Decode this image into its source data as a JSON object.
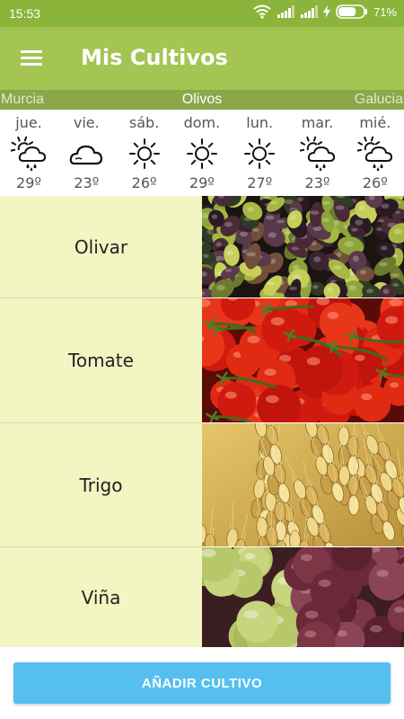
{
  "status_bar": {
    "time": "15:53",
    "battery": "71%",
    "battery_level": 0.71
  },
  "app_bar": {
    "title": "Mis Cultivos",
    "menu_icon": "hamburger-menu-icon"
  },
  "location_bar": {
    "previous": "Murcia",
    "current": "Olivos",
    "next": "Galucia"
  },
  "forecast": [
    {
      "day": "jue.",
      "icon": "sun-cloud-rain-icon",
      "temp": "29º"
    },
    {
      "day": "vie.",
      "icon": "cloud-icon",
      "temp": "23º"
    },
    {
      "day": "sáb.",
      "icon": "sun-icon",
      "temp": "26º"
    },
    {
      "day": "dom.",
      "icon": "sun-icon",
      "temp": "29º"
    },
    {
      "day": "lun.",
      "icon": "sun-icon",
      "temp": "27º"
    },
    {
      "day": "mar.",
      "icon": "sun-cloud-rain-icon",
      "temp": "23º"
    },
    {
      "day": "mié.",
      "icon": "sun-cloud-rain-icon",
      "temp": "26º"
    }
  ],
  "crops": [
    {
      "name": "Olivar",
      "image": "olives-photo"
    },
    {
      "name": "Tomate",
      "image": "tomatoes-photo"
    },
    {
      "name": "Trigo",
      "image": "wheat-photo"
    },
    {
      "name": "Viña",
      "image": "grapes-photo"
    }
  ],
  "add_button": {
    "label": "AÑADIR CULTIVO"
  },
  "colors": {
    "status_bar": "#8bb43b",
    "app_bar": "#a4c552",
    "location_bar": "#8aa84a",
    "crop_label_bg": "#f3f5c3",
    "button": "#55bff0"
  }
}
